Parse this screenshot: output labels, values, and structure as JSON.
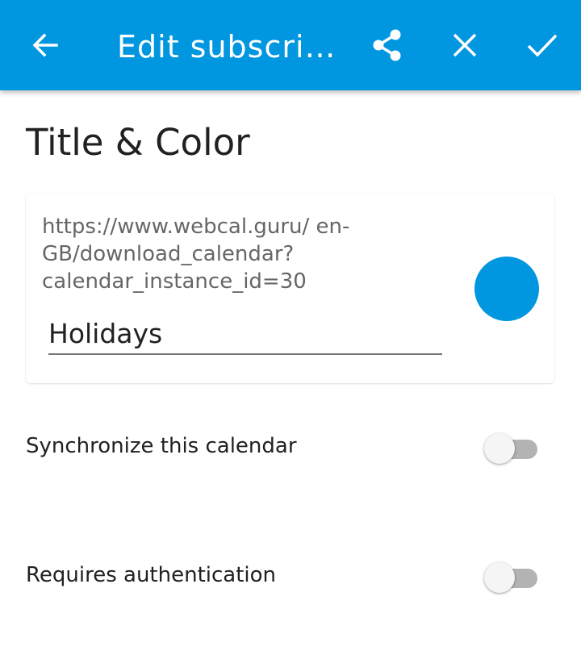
{
  "colors": {
    "appbar": "#0096e0",
    "calendar_color": "#0096e0"
  },
  "toolbar": {
    "back_icon": "arrow-left-icon",
    "title": "Edit subscri…",
    "share_icon": "share-icon",
    "cancel_icon": "close-icon",
    "save_icon": "check-icon"
  },
  "section": {
    "title": "Title & Color"
  },
  "subscription": {
    "url": "https://www.webcal.guru/ en-GB/download_calendar? calendar_instance_id=30",
    "name": "Holidays"
  },
  "settings": {
    "sync": {
      "label": "Synchronize this calendar",
      "enabled": false
    },
    "auth": {
      "label": "Requires authentication",
      "enabled": false
    }
  }
}
